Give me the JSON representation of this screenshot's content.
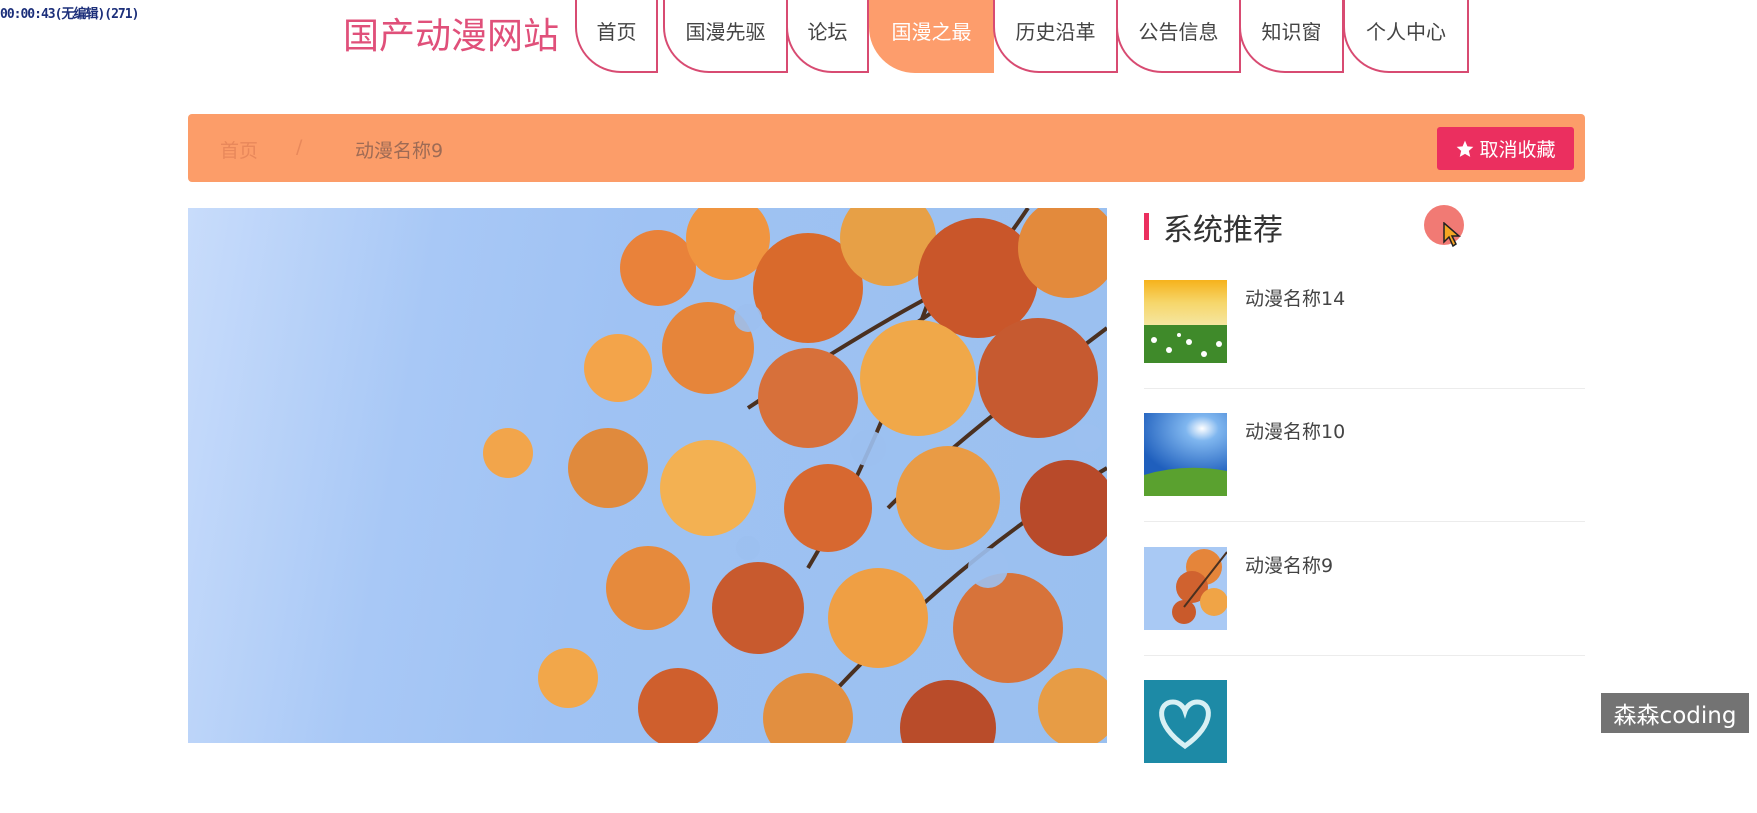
{
  "recording_overlay": "00:00:43(无编辑)(271)",
  "header": {
    "site_title": "国产动漫网站",
    "nav": [
      {
        "label": "首页",
        "active": false
      },
      {
        "label": "国漫先驱",
        "active": false
      },
      {
        "label": "论坛",
        "active": false
      },
      {
        "label": "国漫之最",
        "active": true
      },
      {
        "label": "历史沿革",
        "active": false
      },
      {
        "label": "公告信息",
        "active": false
      },
      {
        "label": "知识窗",
        "active": false
      },
      {
        "label": "个人中心",
        "active": false
      }
    ]
  },
  "breadcrumb": {
    "home": "首页",
    "separator": "/",
    "current": "动漫名称9",
    "action_label": "取消收藏",
    "action_icon": "star-icon"
  },
  "main_image": {
    "subject": "autumn-leaves-photo"
  },
  "sidebar": {
    "heading": "系统推荐",
    "items": [
      {
        "name": "动漫名称14",
        "thumb": "flower-field-thumb"
      },
      {
        "name": "动漫名称10",
        "thumb": "blue-sky-field-thumb"
      },
      {
        "name": "动漫名称9",
        "thumb": "autumn-leaves-thumb"
      },
      {
        "name": "",
        "thumb": "heart-island-thumb"
      }
    ]
  },
  "watermark": "森森coding",
  "colors": {
    "brand": "#e0507a",
    "accent_orange": "#fc9d69",
    "button_red": "#eb2f5f"
  }
}
